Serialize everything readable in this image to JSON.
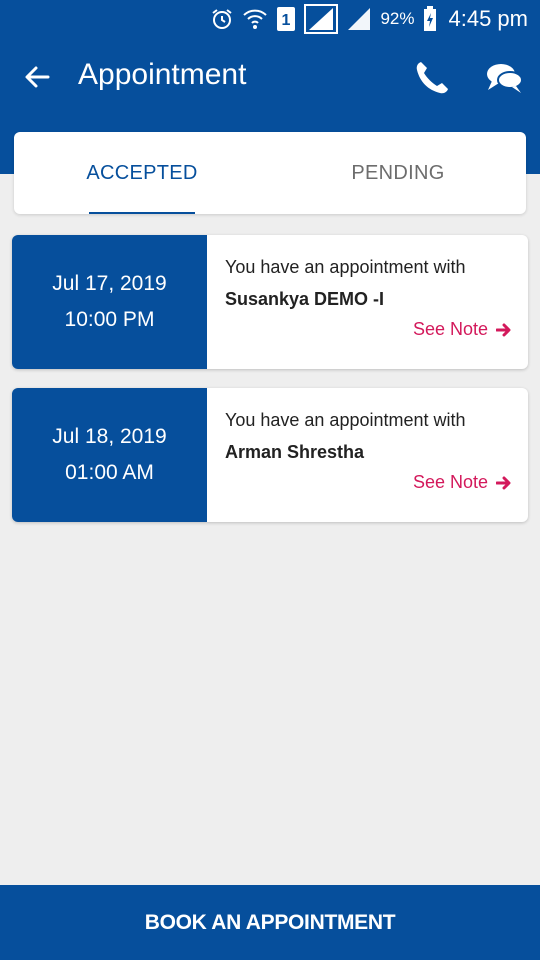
{
  "status_bar": {
    "sim_slot": "1",
    "battery_percent": "92%",
    "time": "4:45 pm"
  },
  "app_bar": {
    "title": "Appointment",
    "icons": [
      "back-arrow-icon",
      "phone-icon",
      "chat-icon"
    ]
  },
  "tabs": [
    {
      "label": "ACCEPTED",
      "selected": true
    },
    {
      "label": "PENDING",
      "selected": false
    }
  ],
  "appointments": [
    {
      "date": "Jul 17, 2019",
      "time": "10:00 PM",
      "message": "You have an appointment with",
      "name": "Susankya DEMO -I",
      "note_label": "See Note"
    },
    {
      "date": "Jul 18, 2019",
      "time": "01:00 AM",
      "message": "You have an appointment with",
      "name": "Arman Shrestha",
      "note_label": "See Note"
    }
  ],
  "footer": {
    "book_label": "BOOK AN APPOINTMENT"
  },
  "colors": {
    "primary": "#064f9c",
    "accent": "#d3195b",
    "background": "#eeeeee"
  }
}
